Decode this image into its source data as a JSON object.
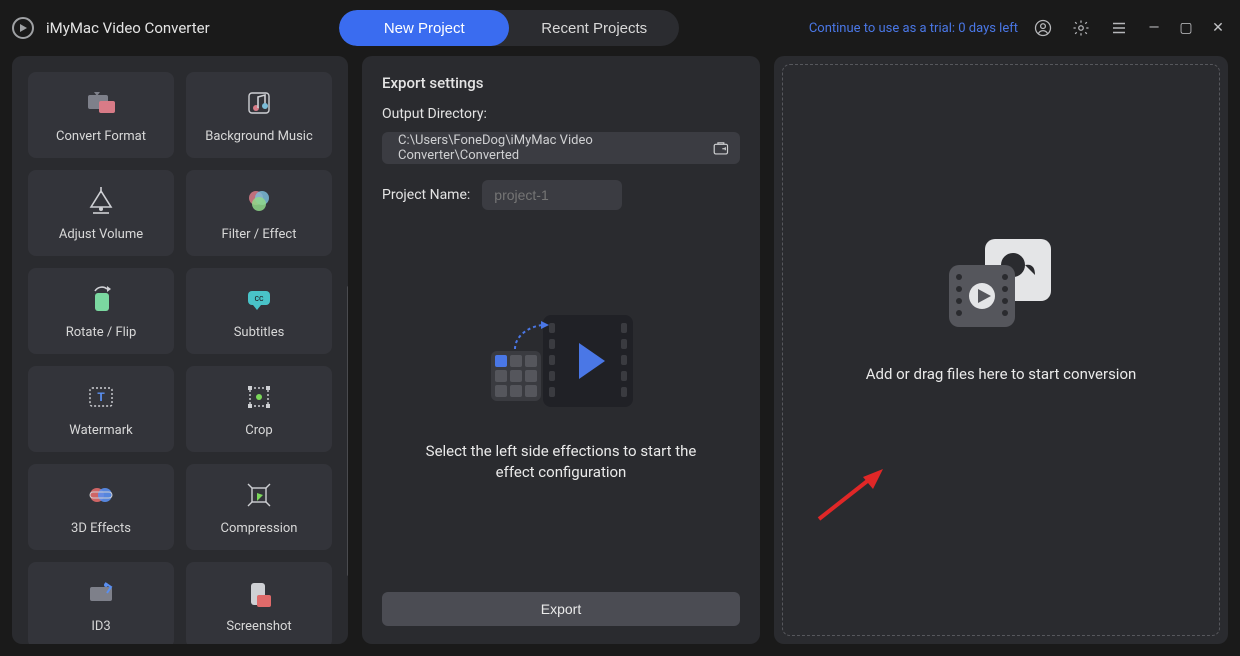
{
  "app": {
    "title": "iMyMac Video Converter"
  },
  "header": {
    "new_project_label": "New Project",
    "recent_projects_label": "Recent Projects",
    "trial_text": "Continue to use as a trial: 0 days left"
  },
  "sidebar": {
    "tools": [
      {
        "id": "convert-format",
        "label": "Convert Format",
        "icon": "convert-icon"
      },
      {
        "id": "background-music",
        "label": "Background Music",
        "icon": "music-icon"
      },
      {
        "id": "adjust-volume",
        "label": "Adjust Volume",
        "icon": "volume-icon"
      },
      {
        "id": "filter-effect",
        "label": "Filter / Effect",
        "icon": "filter-icon"
      },
      {
        "id": "rotate-flip",
        "label": "Rotate / Flip",
        "icon": "rotate-icon"
      },
      {
        "id": "subtitles",
        "label": "Subtitles",
        "icon": "subtitles-icon"
      },
      {
        "id": "watermark",
        "label": "Watermark",
        "icon": "watermark-icon"
      },
      {
        "id": "crop",
        "label": "Crop",
        "icon": "crop-icon"
      },
      {
        "id": "three-d",
        "label": "3D Effects",
        "icon": "threed-icon"
      },
      {
        "id": "compression",
        "label": "Compression",
        "icon": "compress-icon"
      },
      {
        "id": "id3",
        "label": "ID3",
        "icon": "id3-icon"
      },
      {
        "id": "screenshot",
        "label": "Screenshot",
        "icon": "screenshot-icon"
      }
    ]
  },
  "center": {
    "export_settings_title": "Export settings",
    "output_directory_label": "Output Directory:",
    "output_directory_value": "C:\\Users\\FoneDog\\iMyMac Video Converter\\Converted",
    "project_name_label": "Project Name:",
    "project_name_placeholder": "project-1",
    "instruction_text": "Select the left side effections to start the effect configuration",
    "export_button_label": "Export"
  },
  "drop": {
    "hint_text": "Add or drag files here to start conversion"
  },
  "colors": {
    "accent": "#3a6cf0",
    "arrow": "#e02727"
  }
}
